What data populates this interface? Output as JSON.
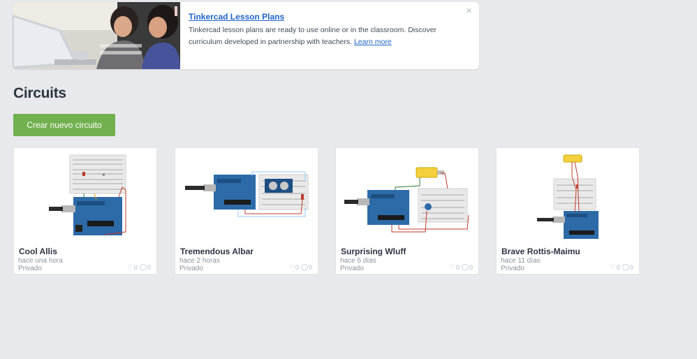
{
  "banner": {
    "title": "Tinkercad Lesson Plans",
    "description": "Tinkercad lesson plans are ready to use online or in the classroom. Discover curriculum developed in partnership with teachers.",
    "link_label": "Learn more",
    "close_symbol": "×",
    "image_icon": "children-at-computer-photo"
  },
  "section": {
    "title": "Circuits"
  },
  "create_button": {
    "label": "Crear nuevo circuito",
    "color": "#72b04f"
  },
  "circuits": [
    {
      "name": "Cool Allis",
      "time": "hace una hora",
      "privacy": "Privado",
      "likes": "0",
      "comments": "0"
    },
    {
      "name": "Tremendous Albar",
      "time": "hace 2 horas",
      "privacy": "Privado",
      "likes": "0",
      "comments": "0"
    },
    {
      "name": "Surprising Wluff",
      "time": "hace 6 días",
      "privacy": "Privado",
      "likes": "0",
      "comments": "0"
    },
    {
      "name": "Brave Rottis-Maimu",
      "time": "hace 11 días",
      "privacy": "Privado",
      "likes": "0",
      "comments": "0"
    }
  ],
  "colors": {
    "background": "#e8e9ec",
    "link": "#1f63c7",
    "arduino_board": "#2c6aa8"
  }
}
